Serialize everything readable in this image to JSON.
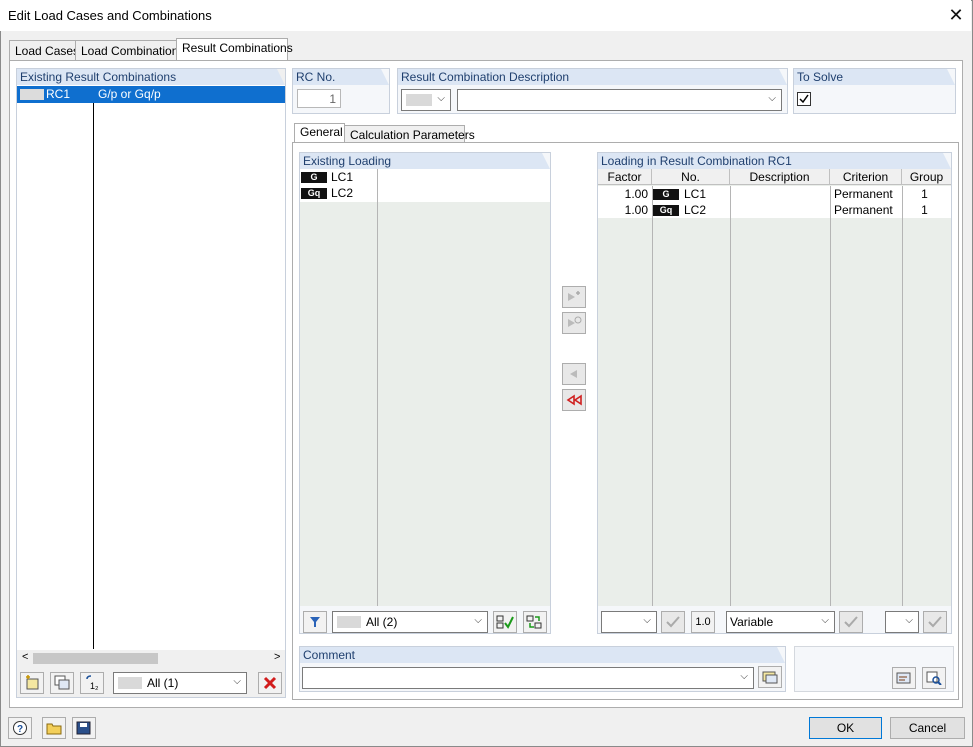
{
  "window": {
    "title": "Edit Load Cases and Combinations",
    "close_glyph": "✕"
  },
  "tabs": [
    {
      "label": "Load Cases"
    },
    {
      "label": "Load Combinations"
    },
    {
      "label": "Result Combinations"
    }
  ],
  "existing": {
    "header": "Existing Result Combinations",
    "rows": [
      {
        "no": "RC1",
        "desc": "G/p or Gq/p"
      }
    ],
    "filter_value": "All (1)",
    "scroll_left": "<",
    "scroll_right": ">"
  },
  "rc_no": {
    "label": "RC No.",
    "value": "1"
  },
  "description": {
    "label": "Result Combination Description",
    "value": ""
  },
  "to_solve": {
    "label": "To Solve",
    "checked": true
  },
  "inner_tabs": [
    {
      "label": "General"
    },
    {
      "label": "Calculation Parameters"
    }
  ],
  "existing_loading": {
    "header": "Existing Loading",
    "rows": [
      {
        "badge": "G",
        "name": "LC1"
      },
      {
        "badge": "Gq",
        "name": "LC2"
      }
    ],
    "filter_value": "All (2)"
  },
  "loading_rc": {
    "header": "Loading in Result Combination RC1",
    "columns": [
      "Factor",
      "No.",
      "Description",
      "Criterion",
      "Group"
    ],
    "rows": [
      {
        "factor": "1.00",
        "badge": "G",
        "no": "LC1",
        "description": "",
        "criterion": "Permanent",
        "group": "1"
      },
      {
        "factor": "1.00",
        "badge": "Gq",
        "no": "LC2",
        "description": "",
        "criterion": "Permanent",
        "group": "1"
      }
    ],
    "factor_btn": "1.0",
    "criterion_value": "Variable"
  },
  "comment": {
    "label": "Comment",
    "value": ""
  },
  "footer": {
    "ok": "OK",
    "cancel": "Cancel"
  }
}
